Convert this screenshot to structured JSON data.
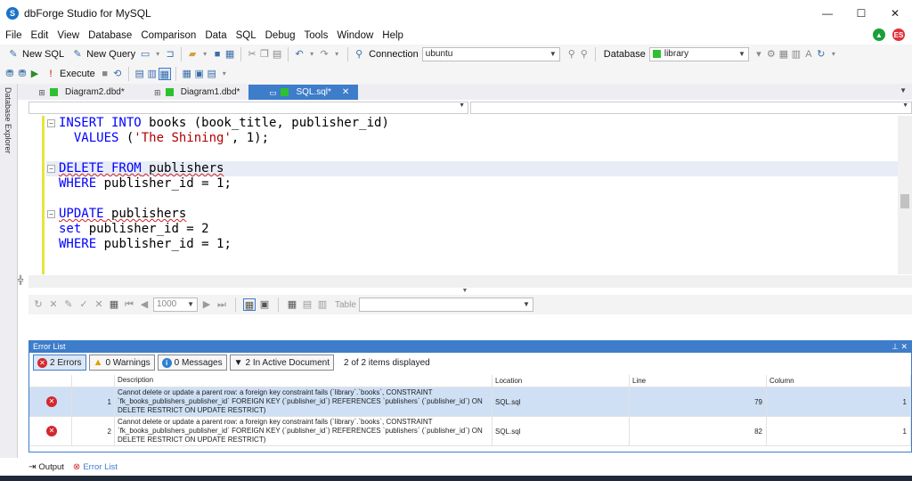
{
  "window": {
    "title": "dbForge Studio for MySQL",
    "controls": {
      "minimize": "—",
      "maximize": "☐",
      "close": "✕"
    }
  },
  "menu": {
    "items": [
      "File",
      "Edit",
      "View",
      "Database",
      "Comparison",
      "Data",
      "SQL",
      "Debug",
      "Tools",
      "Window",
      "Help"
    ],
    "user_badge": "ES",
    "accent_green": "#1a9f3a",
    "accent_red": "#e0303a"
  },
  "toolbar1": {
    "new_sql": "New SQL",
    "new_query": "New Query",
    "connection_label": "Connection",
    "connection_value": "ubuntu",
    "database_label": "Database",
    "database_value": "library"
  },
  "toolbar2": {
    "execute": "Execute"
  },
  "sidebar": {
    "database_explorer": "Database Explorer"
  },
  "doc_tabs": [
    {
      "label": "Diagram2.dbd*",
      "active": false
    },
    {
      "label": "Diagram1.dbd*",
      "active": false
    },
    {
      "label": "SQL.sql*",
      "active": true
    }
  ],
  "editor": {
    "lines": [
      "INSERT INTO books (book_title, publisher_id)",
      "  VALUES ('The Shining', 1);",
      "",
      "DELETE FROM publishers",
      "WHERE publisher_id = 1;",
      "",
      "UPDATE publishers",
      "set publisher_id = 2",
      "WHERE publisher_id = 1;"
    ]
  },
  "grid_toolbar": {
    "page_size": "1000",
    "table_label": "Table"
  },
  "error_list": {
    "title": "Error List",
    "filters": {
      "errors": "2 Errors",
      "warnings": "0 Warnings",
      "messages": "0 Messages",
      "active_doc": "2 In Active Document"
    },
    "summary": "2 of 2 items displayed",
    "columns": [
      "Description",
      "Location",
      "Line",
      "Column"
    ],
    "rows": [
      {
        "num": "1",
        "description": "Cannot delete or update a parent row: a foreign key constraint fails (`library`.`books`, CONSTRAINT `fk_books_publishers_publisher_id` FOREIGN KEY (`publisher_id`) REFERENCES `publishers` (`publisher_id`) ON DELETE RESTRICT ON UPDATE RESTRICT)",
        "location": "SQL.sql",
        "line": "79",
        "column": "1"
      },
      {
        "num": "2",
        "description": "Cannot delete or update a parent row: a foreign key constraint fails (`library`.`books`, CONSTRAINT `fk_books_publishers_publisher_id` FOREIGN KEY (`publisher_id`) REFERENCES `publishers` (`publisher_id`) ON DELETE RESTRICT ON UPDATE RESTRICT)",
        "location": "SQL.sql",
        "line": "82",
        "column": "1"
      }
    ]
  },
  "bottom_tabs": {
    "output": "Output",
    "error_list": "Error List"
  }
}
